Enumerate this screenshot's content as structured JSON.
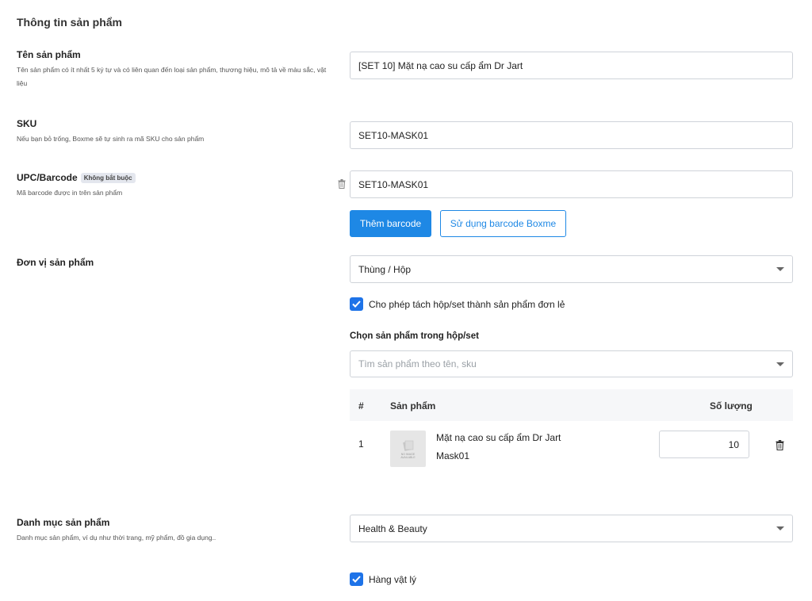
{
  "section_title": "Thông tin sản phẩm",
  "product_name": {
    "label": "Tên sản phẩm",
    "description": "Tên sản phẩm có ít nhất 5 ký tự và có liên quan đến loại sản phẩm, thương hiệu, mô tả về màu sắc, vật liệu",
    "value": "[SET 10] Mặt nạ cao su cấp ẩm Dr Jart"
  },
  "sku": {
    "label": "SKU",
    "description": "Nếu bạn bỏ trống, Boxme sẽ tự sinh ra mã SKU cho sản phẩm",
    "value": "SET10-MASK01"
  },
  "barcode": {
    "label": "UPC/Barcode",
    "badge": "Không bắt buộc",
    "description": "Mã barcode được in trên sản phẩm",
    "value": "SET10-MASK01",
    "add_button": "Thêm barcode",
    "use_boxme_button": "Sử dụng barcode Boxme"
  },
  "unit": {
    "label": "Đơn vị sản phẩm",
    "value": "Thùng / Hộp",
    "split_checkbox_label": "Cho phép tách hộp/set thành sản phẩm đơn lẻ",
    "split_checked": true,
    "choose_label": "Chọn sản phẩm trong hộp/set",
    "search_placeholder": "Tìm sản phẩm theo tên, sku"
  },
  "table": {
    "headers": {
      "index": "#",
      "product": "Sản phẩm",
      "quantity": "Số lượng"
    },
    "rows": [
      {
        "index": "1",
        "name": "Mặt nạ cao su cấp ẩm Dr Jart",
        "sku": "Mask01",
        "quantity": "10",
        "thumb_text": "NO IMAGE AVAILABLE"
      }
    ]
  },
  "category": {
    "label": "Danh mục sản phẩm",
    "description": "Danh mục sản phẩm, ví dụ như thời trang, mỹ phẩm, đồ gia dụng..",
    "value": "Health & Beauty"
  },
  "physical": {
    "label": "Hàng vật lý",
    "checked": true
  },
  "colors": {
    "accent": "#1e88e5",
    "checkbox": "#1e73e8"
  }
}
